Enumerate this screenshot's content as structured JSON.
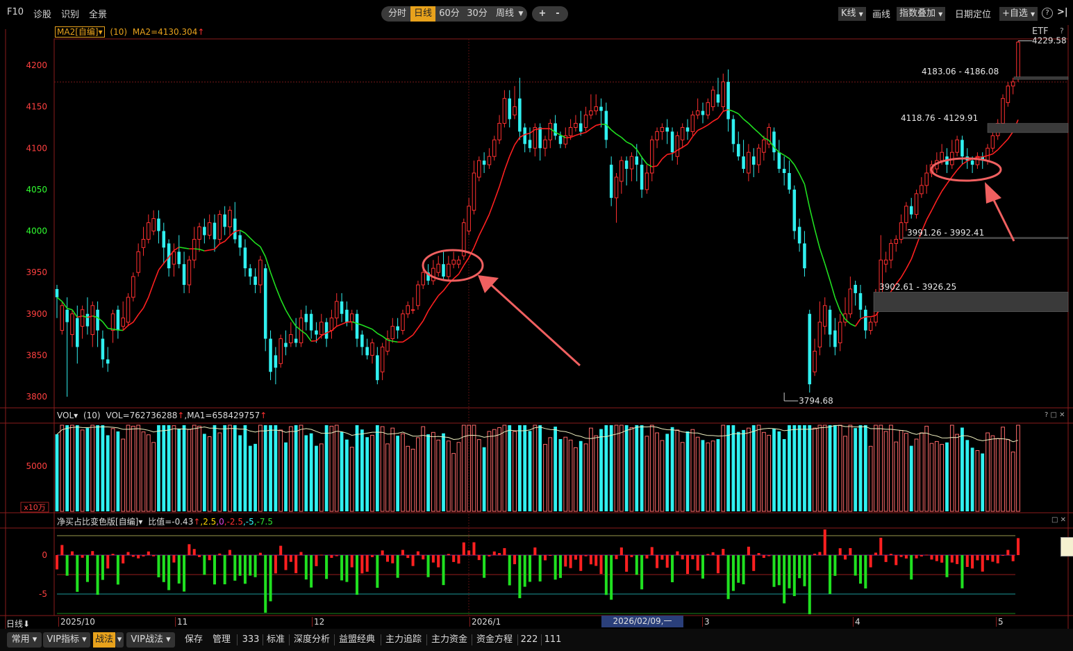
{
  "toolbar": {
    "left": [
      "F10",
      "诊股",
      "识别",
      "全景"
    ],
    "periods": [
      "分时",
      "日线",
      "60分",
      "30分",
      "周线"
    ],
    "active_period": "日线",
    "zoom_in": "+",
    "zoom_out": "-",
    "right": {
      "kline": "K线",
      "draw": "画线",
      "overlay": "指数叠加",
      "date_locate": "日期定位",
      "watchlist": "+自选",
      "help": "?"
    }
  },
  "main_panel": {
    "indicator_name": "MA2[自编]",
    "period": "(10)",
    "ma_value": "MA2=4130.304",
    "etf_label": "ETF",
    "high_label": "4229.58",
    "low_label": "3794.68",
    "zones": [
      "4183.06 - 4186.08",
      "4118.76 - 4129.91",
      "3991.26 - 3992.41",
      "3902.61 - 3926.25"
    ]
  },
  "volume_panel": {
    "name": "VOL",
    "period": "(10)",
    "vol_value": "VOL=762736288",
    "ma_value": ",MA1=658429757",
    "unit": "x10万"
  },
  "net_panel": {
    "name": "净买占比变色版[自编]",
    "ratio_label": "比值=-0.43",
    "levels": [
      ",2.5",
      ",0",
      ",-2.5",
      ",-5",
      ",-7.5"
    ]
  },
  "bottom": {
    "period_label": "日线",
    "date_labels": [
      "2025/10",
      "11",
      "12",
      "2026/1",
      "3",
      "4",
      "5"
    ],
    "cursor_date": "2026/02/09,一",
    "buttons": [
      "常用",
      "VIP指标",
      "战法",
      "VIP战法",
      "保存",
      "管理",
      "333",
      "标准",
      "深度分析",
      "益盟经典",
      "主力追踪",
      "主力资金",
      "资金方程",
      "222",
      "111"
    ]
  },
  "chart_data": {
    "type": "candlestick",
    "y_ticks": [
      3800,
      3850,
      3900,
      3950,
      4000,
      4050,
      4100,
      4150,
      4200
    ],
    "ylim": [
      3775,
      4243
    ],
    "vol_tick": "5000",
    "net_ticks": [
      "0",
      "-5"
    ],
    "candles": [
      [
        3930,
        3920,
        3935,
        3895
      ],
      [
        3880,
        3910,
        3915,
        3875
      ],
      [
        3905,
        3890,
        3920,
        3800
      ],
      [
        3875,
        3900,
        3905,
        3860
      ],
      [
        3895,
        3860,
        3910,
        3840
      ],
      [
        3885,
        3905,
        3910,
        3870
      ],
      [
        3900,
        3885,
        3920,
        3875
      ],
      [
        3875,
        3910,
        3915,
        3860
      ],
      [
        3905,
        3880,
        3915,
        3860
      ],
      [
        3870,
        3845,
        3880,
        3835
      ],
      [
        3845,
        3840,
        3860,
        3830
      ],
      [
        3880,
        3900,
        3905,
        3865
      ],
      [
        3905,
        3880,
        3910,
        3870
      ],
      [
        3885,
        3895,
        3915,
        3880
      ],
      [
        3890,
        3920,
        3925,
        3885
      ],
      [
        3920,
        3945,
        3950,
        3915
      ],
      [
        3950,
        3975,
        3985,
        3945
      ],
      [
        3980,
        3990,
        4005,
        3970
      ],
      [
        3990,
        4010,
        4020,
        3985
      ],
      [
        4000,
        4015,
        4025,
        3995
      ],
      [
        4015,
        4000,
        4025,
        3985
      ],
      [
        4000,
        3980,
        4010,
        3960
      ],
      [
        3985,
        3955,
        3990,
        3945
      ],
      [
        3960,
        3975,
        3985,
        3945
      ],
      [
        3975,
        3960,
        3995,
        3955
      ],
      [
        3960,
        3935,
        3975,
        3925
      ],
      [
        3935,
        3965,
        3970,
        3925
      ],
      [
        3965,
        3990,
        4005,
        3955
      ],
      [
        3990,
        4005,
        4010,
        3975
      ],
      [
        4005,
        3995,
        4015,
        3985
      ],
      [
        3995,
        4010,
        4020,
        3990
      ],
      [
        4010,
        3990,
        4020,
        3975
      ],
      [
        3990,
        4020,
        4025,
        3985
      ],
      [
        4020,
        4005,
        4030,
        3995
      ],
      [
        4005,
        4025,
        4030,
        3995
      ],
      [
        4015,
        3990,
        4035,
        3985
      ],
      [
        3995,
        3980,
        4000,
        3970
      ],
      [
        3980,
        3955,
        3990,
        3945
      ],
      [
        3955,
        3945,
        3960,
        3935
      ],
      [
        3945,
        3935,
        3955,
        3925
      ],
      [
        3935,
        3965,
        3970,
        3925
      ],
      [
        3955,
        3870,
        3960,
        3855
      ],
      [
        3870,
        3830,
        3880,
        3820
      ],
      [
        3850,
        3835,
        3860,
        3815
      ],
      [
        3840,
        3870,
        3875,
        3835
      ],
      [
        3865,
        3860,
        3880,
        3850
      ],
      [
        3865,
        3875,
        3890,
        3860
      ],
      [
        3870,
        3865,
        3895,
        3860
      ],
      [
        3865,
        3895,
        3905,
        3860
      ],
      [
        3900,
        3890,
        3910,
        3880
      ],
      [
        3900,
        3880,
        3905,
        3870
      ],
      [
        3880,
        3875,
        3890,
        3865
      ],
      [
        3875,
        3890,
        3900,
        3870
      ],
      [
        3890,
        3870,
        3895,
        3860
      ],
      [
        3880,
        3895,
        3905,
        3870
      ],
      [
        3895,
        3915,
        3925,
        3885
      ],
      [
        3915,
        3900,
        3925,
        3890
      ],
      [
        3905,
        3890,
        3915,
        3885
      ],
      [
        3890,
        3900,
        3905,
        3880
      ],
      [
        3900,
        3870,
        3905,
        3860
      ],
      [
        3875,
        3860,
        3880,
        3850
      ],
      [
        3860,
        3850,
        3870,
        3845
      ],
      [
        3850,
        3865,
        3870,
        3840
      ],
      [
        3850,
        3820,
        3860,
        3815
      ],
      [
        3830,
        3860,
        3865,
        3820
      ],
      [
        3855,
        3870,
        3880,
        3850
      ],
      [
        3870,
        3885,
        3895,
        3865
      ],
      [
        3885,
        3880,
        3895,
        3870
      ],
      [
        3880,
        3900,
        3905,
        3875
      ],
      [
        3900,
        3910,
        3915,
        3895
      ],
      [
        3905,
        3905,
        3920,
        3900
      ],
      [
        3910,
        3935,
        3940,
        3905
      ],
      [
        3935,
        3950,
        3960,
        3930
      ],
      [
        3950,
        3940,
        3960,
        3935
      ],
      [
        3940,
        3955,
        3965,
        3935
      ],
      [
        3950,
        3960,
        3970,
        3945
      ],
      [
        3960,
        3945,
        3975,
        3940
      ],
      [
        3945,
        3960,
        3970,
        3940
      ],
      [
        3960,
        3965,
        3975,
        3955
      ],
      [
        3960,
        3965,
        3970,
        3955
      ],
      [
        3970,
        4010,
        4015,
        3965
      ],
      [
        4000,
        4030,
        4040,
        3995
      ],
      [
        4025,
        4070,
        4085,
        4020
      ],
      [
        4065,
        4085,
        4090,
        4060
      ],
      [
        4085,
        4080,
        4095,
        4070
      ],
      [
        4080,
        4090,
        4100,
        4075
      ],
      [
        4090,
        4110,
        4115,
        4085
      ],
      [
        4110,
        4130,
        4140,
        4105
      ],
      [
        4130,
        4160,
        4170,
        4125
      ],
      [
        4160,
        4135,
        4170,
        4125
      ],
      [
        4140,
        4150,
        4175,
        4135
      ],
      [
        4160,
        4120,
        4185,
        4110
      ],
      [
        4125,
        4105,
        4130,
        4095
      ],
      [
        4110,
        4100,
        4125,
        4095
      ],
      [
        4100,
        4125,
        4130,
        4090
      ],
      [
        4125,
        4100,
        4130,
        4085
      ],
      [
        4100,
        4110,
        4115,
        4090
      ],
      [
        4110,
        4130,
        4135,
        4100
      ],
      [
        4130,
        4115,
        4140,
        4110
      ],
      [
        4115,
        4105,
        4120,
        4100
      ],
      [
        4105,
        4115,
        4125,
        4100
      ],
      [
        4115,
        4125,
        4135,
        4110
      ],
      [
        4125,
        4130,
        4140,
        4120
      ],
      [
        4130,
        4120,
        4145,
        4115
      ],
      [
        4125,
        4140,
        4150,
        4120
      ],
      [
        4140,
        4145,
        4165,
        4135
      ],
      [
        4145,
        4150,
        4165,
        4140
      ],
      [
        4150,
        4145,
        4160,
        4125
      ],
      [
        4145,
        4110,
        4155,
        4100
      ],
      [
        4080,
        4040,
        4090,
        4030
      ],
      [
        4040,
        4065,
        4070,
        4010
      ],
      [
        4060,
        4085,
        4090,
        4045
      ],
      [
        4085,
        4075,
        4090,
        4055
      ],
      [
        4075,
        4090,
        4095,
        4060
      ],
      [
        4090,
        4080,
        4105,
        4060
      ],
      [
        4080,
        4050,
        4090,
        4040
      ],
      [
        4050,
        4070,
        4080,
        4045
      ],
      [
        4070,
        4110,
        4115,
        4060
      ],
      [
        4110,
        4120,
        4125,
        4100
      ],
      [
        4120,
        4125,
        4130,
        4110
      ],
      [
        4125,
        4120,
        4135,
        4105
      ],
      [
        4120,
        4095,
        4125,
        4085
      ],
      [
        4090,
        4115,
        4120,
        4080
      ],
      [
        4110,
        4125,
        4130,
        4100
      ],
      [
        4125,
        4120,
        4135,
        4110
      ],
      [
        4120,
        4140,
        4145,
        4115
      ],
      [
        4140,
        4145,
        4160,
        4135
      ],
      [
        4145,
        4140,
        4155,
        4130
      ],
      [
        4140,
        4155,
        4160,
        4135
      ],
      [
        4150,
        4170,
        4175,
        4145
      ],
      [
        4165,
        4155,
        4185,
        4150
      ],
      [
        4150,
        4180,
        4190,
        4145
      ],
      [
        4180,
        4135,
        4195,
        4120
      ],
      [
        4135,
        4105,
        4140,
        4095
      ],
      [
        4105,
        4090,
        4120,
        4085
      ],
      [
        4090,
        4075,
        4110,
        4070
      ],
      [
        4070,
        4095,
        4105,
        4060
      ],
      [
        4090,
        4080,
        4100,
        4065
      ],
      [
        4080,
        4100,
        4105,
        4070
      ],
      [
        4095,
        4110,
        4115,
        4085
      ],
      [
        4105,
        4125,
        4130,
        4100
      ],
      [
        4120,
        4095,
        4125,
        4085
      ],
      [
        4095,
        4075,
        4110,
        4070
      ],
      [
        4075,
        4070,
        4090,
        4055
      ],
      [
        4070,
        4050,
        4085,
        4045
      ],
      [
        4050,
        4000,
        4055,
        3990
      ],
      [
        4005,
        3985,
        4015,
        3975
      ],
      [
        3985,
        3955,
        4000,
        3945
      ],
      [
        3900,
        3815,
        3905,
        3805
      ],
      [
        3830,
        3855,
        3870,
        3825
      ],
      [
        3860,
        3890,
        3915,
        3850
      ],
      [
        3885,
        3910,
        3920,
        3875
      ],
      [
        3905,
        3875,
        3910,
        3860
      ],
      [
        3880,
        3860,
        3895,
        3850
      ],
      [
        3865,
        3890,
        3900,
        3855
      ],
      [
        3890,
        3900,
        3920,
        3885
      ],
      [
        3900,
        3930,
        3945,
        3895
      ],
      [
        3935,
        3925,
        3940,
        3910
      ],
      [
        3925,
        3905,
        3935,
        3895
      ],
      [
        3905,
        3880,
        3910,
        3870
      ],
      [
        3880,
        3890,
        3895,
        3875
      ],
      [
        3890,
        3925,
        3930,
        3885
      ],
      [
        3925,
        3965,
        3995,
        3920
      ],
      [
        3960,
        3965,
        3975,
        3950
      ],
      [
        3965,
        3985,
        3990,
        3955
      ],
      [
        3985,
        3990,
        3995,
        3975
      ],
      [
        3990,
        4010,
        4020,
        3985
      ],
      [
        4010,
        4030,
        4035,
        4000
      ],
      [
        4030,
        4020,
        4040,
        4015
      ],
      [
        4020,
        4045,
        4050,
        4015
      ],
      [
        4045,
        4055,
        4065,
        4040
      ],
      [
        4055,
        4070,
        4080,
        4045
      ],
      [
        4070,
        4080,
        4085,
        4065
      ],
      [
        4075,
        4085,
        4095,
        4070
      ],
      [
        4085,
        4095,
        4105,
        4080
      ],
      [
        4090,
        4080,
        4100,
        4070
      ],
      [
        4080,
        4095,
        4110,
        4075
      ],
      [
        4095,
        4110,
        4115,
        4090
      ],
      [
        4110,
        4090,
        4115,
        4080
      ],
      [
        4090,
        4085,
        4100,
        4075
      ],
      [
        4085,
        4080,
        4090,
        4070
      ],
      [
        4080,
        4090,
        4095,
        4075
      ],
      [
        4090,
        4085,
        4095,
        4075
      ],
      [
        4085,
        4100,
        4105,
        4080
      ],
      [
        4100,
        4115,
        4120,
        4095
      ],
      [
        4115,
        4130,
        4135,
        4110
      ],
      [
        4130,
        4160,
        4165,
        4125
      ],
      [
        4155,
        4175,
        4180,
        4150
      ],
      [
        4175,
        4180,
        4185,
        4165
      ],
      [
        4185,
        4228,
        4229.58,
        4180
      ]
    ],
    "ma_color_rule": "red when rising, green when falling"
  }
}
